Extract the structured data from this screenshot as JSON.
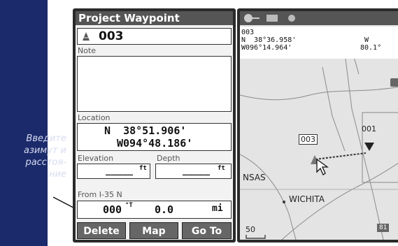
{
  "callout": {
    "lines": [
      "Введите",
      "азимут и",
      "расстоя-",
      "ние"
    ]
  },
  "waypoint_page": {
    "title": "Project Waypoint",
    "name": "003",
    "symbol_icon": "waypoint-symbol-icon",
    "note_label": "Note",
    "note_value": "",
    "location_label": "Location",
    "lat": "N  38°51.906'",
    "lon": "W094°48.186'",
    "elevation_label": "Elevation",
    "elevation_value": "_____",
    "elevation_unit": "ft",
    "depth_label": "Depth",
    "depth_value": "_____",
    "depth_unit": "ft",
    "from_label": "From I-35 N",
    "bearing_value": "000",
    "bearing_unit": "°T",
    "distance_value": "0.0",
    "distance_unit": "mi",
    "buttons": {
      "delete": "Delete",
      "map": "Map",
      "goto": "Go To"
    }
  },
  "map_page": {
    "top_icons": [
      "gps-status-icon",
      "satellite-icon",
      "signal-icon"
    ],
    "wp_name": "003",
    "lat": "N  38°36.958'",
    "lon": "W096°14.964'",
    "right_dir": "W",
    "right_value": "80.1°",
    "labels": {
      "waypoint": "003",
      "point": "001",
      "state": "NSAS",
      "city": "WICHITA",
      "scale": "50",
      "highway": "81"
    }
  }
}
